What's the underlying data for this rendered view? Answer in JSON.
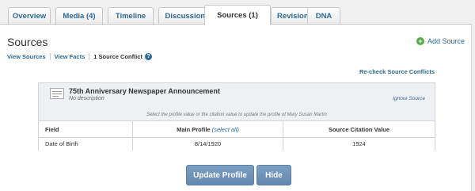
{
  "tabs": [
    {
      "label": "Overview",
      "active": false
    },
    {
      "label": "Media (4)",
      "active": false
    },
    {
      "label": "Timeline",
      "active": false
    },
    {
      "label": "Discussions",
      "active": false
    },
    {
      "label": "Sources (1)",
      "active": true
    },
    {
      "label": "Revisions",
      "active": false
    },
    {
      "label": "DNA",
      "active": false
    }
  ],
  "header": {
    "title": "Sources",
    "add_source": "Add Source"
  },
  "subnav": {
    "view_sources": "View Sources",
    "view_facts": "View Facts",
    "conflict": "1 Source Conflict"
  },
  "recheck": "Re-check Source Conflicts",
  "source": {
    "title": "75th Anniversary Newspaper Announcement",
    "description": "No description",
    "ignore": "Ignore Source",
    "instruction": "Select the profile value or the citation value to update the profile of Mary Susan Martin"
  },
  "table": {
    "headers": {
      "field": "Field",
      "main_profile": "Main Profile",
      "select_all": "(select all)",
      "citation": "Source Citation Value"
    },
    "rows": [
      {
        "field": "Date of Birth",
        "profile": "8/14/1920",
        "citation": "1924"
      }
    ]
  },
  "buttons": {
    "update": "Update Profile",
    "hide": "Hide"
  },
  "colors": {
    "link": "#2e6a97",
    "button": "#6f93bb",
    "add_icon": "#5aa84a"
  }
}
